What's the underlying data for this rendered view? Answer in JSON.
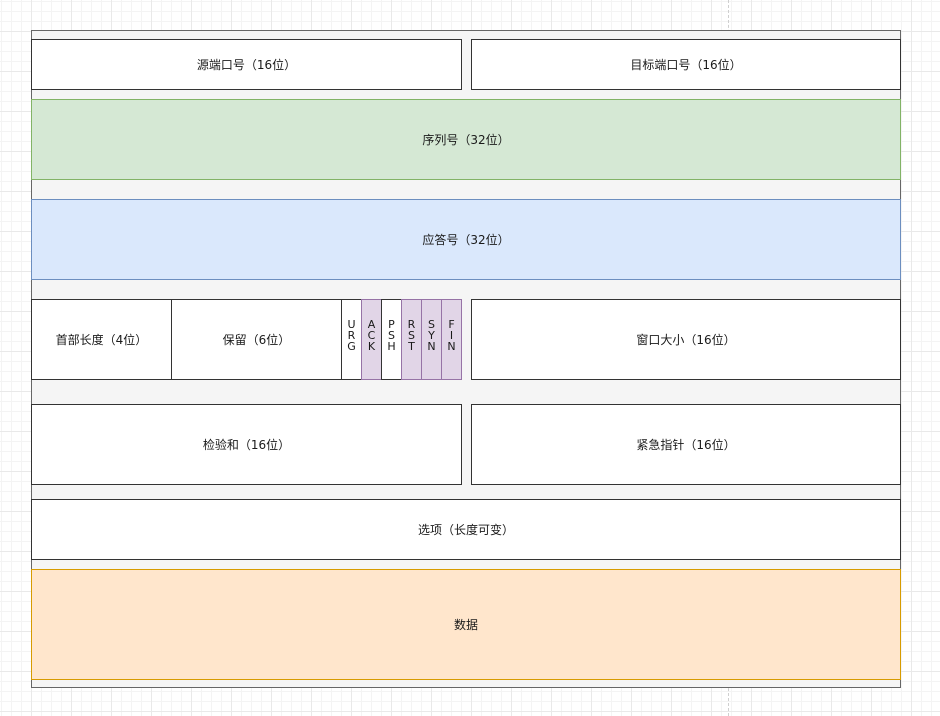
{
  "fields": {
    "source_port": "源端口号（16位）",
    "dest_port": "目标端口号（16位）",
    "sequence_number": "序列号（32位）",
    "ack_number": "应答号（32位）",
    "header_length": "首部长度（4位）",
    "reserved": "保留（6位）",
    "window_size": "窗口大小（16位）",
    "checksum": "检验和（16位）",
    "urgent_pointer": "紧急指针（16位）",
    "options": "选项（长度可变）",
    "data": "数据"
  },
  "flags": [
    {
      "letters": [
        "U",
        "R",
        "G"
      ],
      "highlighted": false
    },
    {
      "letters": [
        "A",
        "C",
        "K"
      ],
      "highlighted": true
    },
    {
      "letters": [
        "P",
        "S",
        "H"
      ],
      "highlighted": false
    },
    {
      "letters": [
        "R",
        "S",
        "T"
      ],
      "highlighted": true
    },
    {
      "letters": [
        "S",
        "Y",
        "N"
      ],
      "highlighted": true
    },
    {
      "letters": [
        "F",
        "I",
        "N"
      ],
      "highlighted": true
    }
  ],
  "colors": {
    "green_fill": "#d5e8d4",
    "blue_fill": "#dae8fc",
    "purple_fill": "#e1d5e7",
    "orange_fill": "#ffe6cc"
  }
}
